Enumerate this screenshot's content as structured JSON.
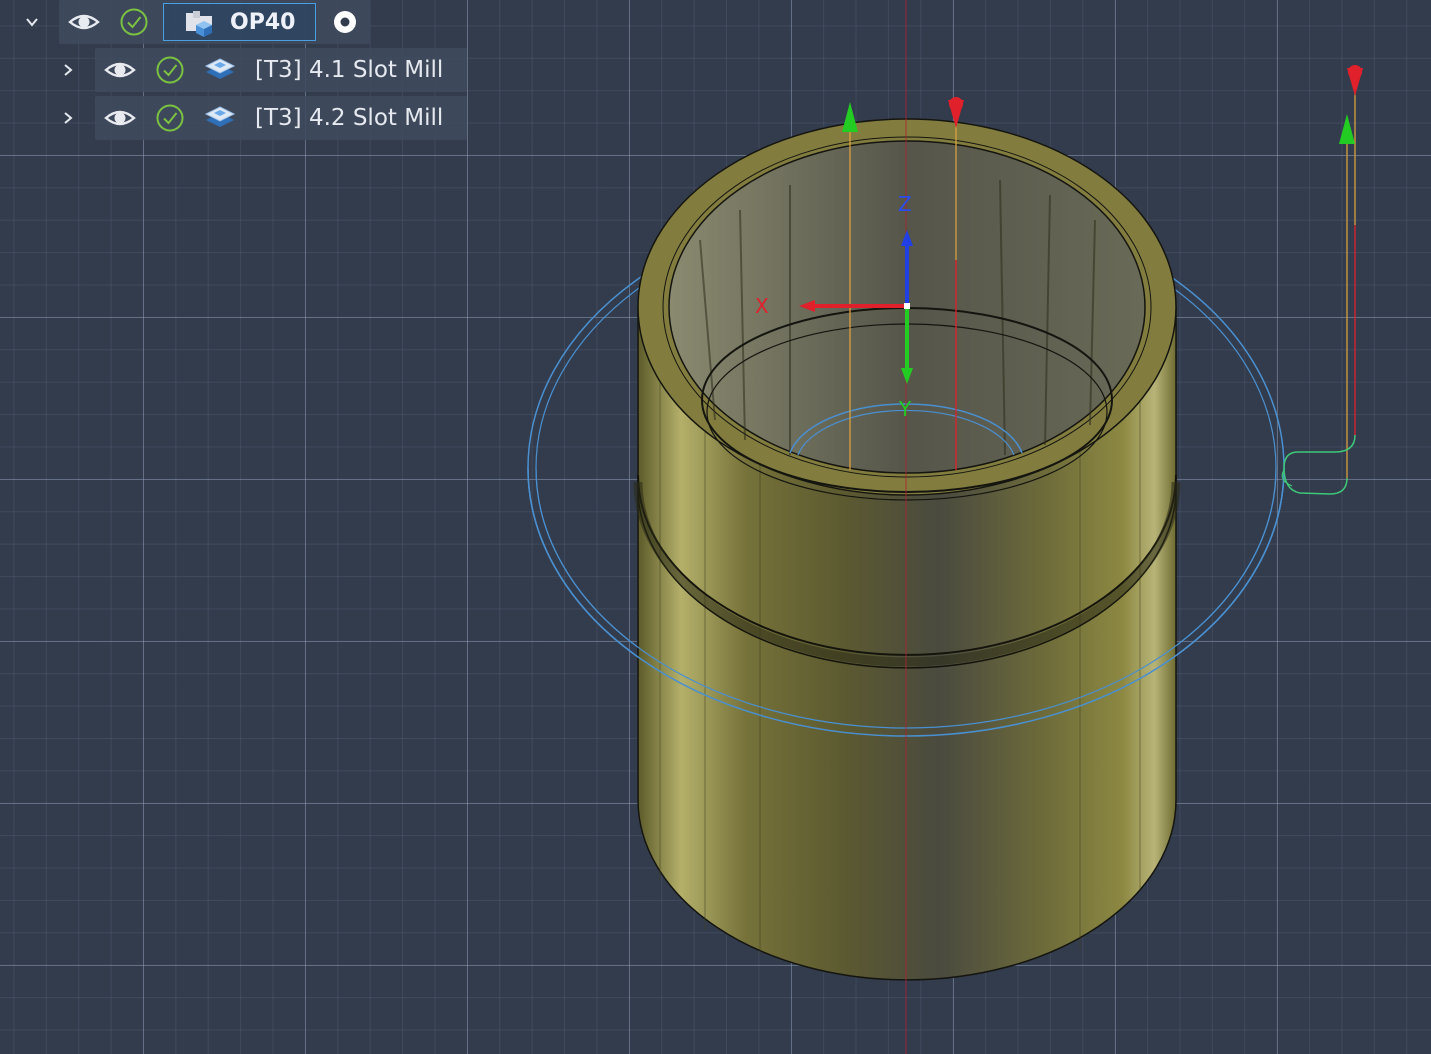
{
  "browser_tree": {
    "setup": {
      "label": "OP40",
      "expanded": true,
      "icons": [
        "chevron-down-icon",
        "eye-icon",
        "check-circle-icon",
        "setup-folder-icon",
        "active-setup-radio-icon"
      ]
    },
    "operations": [
      {
        "label": "[T3] 4.1 Slot Mill",
        "expanded": false,
        "icons": [
          "chevron-right-icon",
          "eye-icon",
          "check-circle-icon",
          "slot-mill-operation-icon"
        ]
      },
      {
        "label": "[T3] 4.2 Slot Mill",
        "expanded": false,
        "icons": [
          "chevron-right-icon",
          "eye-icon",
          "check-circle-icon",
          "slot-mill-operation-icon"
        ]
      }
    ]
  },
  "viewport": {
    "axes": {
      "x": "X",
      "y": "Y",
      "z": "Z"
    },
    "colors": {
      "background": "#333c4d",
      "part_body": "#7d7a3c",
      "x_axis": "#e0202a",
      "y_axis": "#22cc22",
      "z_axis": "#2040e6",
      "toolpath_link": "#4a90d0",
      "rapid_marker": "#e0202a",
      "feed_marker": "#22cc22",
      "tree_selection": "#4a9fe0",
      "check_icon": "#7cc242"
    }
  }
}
